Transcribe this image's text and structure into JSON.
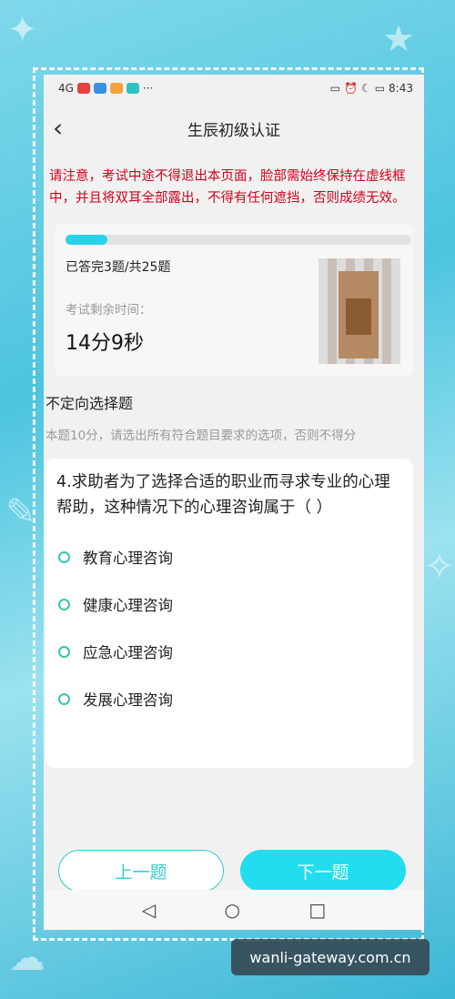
{
  "status_bar": {
    "time": "8:43",
    "network": "4G",
    "battery_icon": "battery-icon"
  },
  "header": {
    "title": "生辰初级认证",
    "back_icon": "chevron-left-icon"
  },
  "warning": "请注意，考试中途不得退出本页面，脸部需始终保持在虚线框中，并且将双耳全部露出，不得有任何遮挡，否则成绩无效。",
  "progress": {
    "answered_text": "已答完3题/共25题",
    "fraction": 0.12,
    "color": "#28d3ea"
  },
  "timer": {
    "label": "考试剩余时间：",
    "value": "14分9秒"
  },
  "question_section": {
    "type": "不定向选择题",
    "instructions": "本题10分，请选出所有符合题目要求的选项，否则不得分",
    "question": "4.求助者为了选择合适的职业而寻求专业的心理帮助，这种情况下的心理咨询属于（    ）",
    "options": [
      "教育心理咨询",
      "健康心理咨询",
      "应急心理咨询",
      "发展心理咨询"
    ]
  },
  "buttons": {
    "prev": "上一题",
    "next": "下一题"
  },
  "accent_color": "#22dcef",
  "warning_color": "#d0021b",
  "watermark": "wanli-gateway.com.cn"
}
